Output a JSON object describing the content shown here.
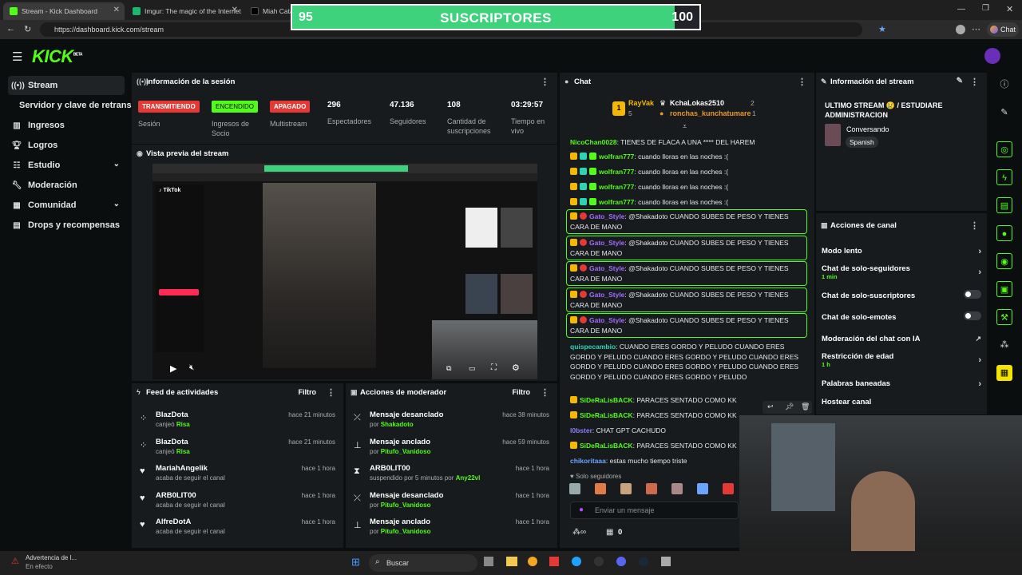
{
  "browser": {
    "tabs": [
      {
        "title": "Stream - Kick Dashboard",
        "active": true
      },
      {
        "title": "Imgur: The magic of the Internet",
        "active": false
      },
      {
        "title": "Miah Catali",
        "active": false
      }
    ],
    "url": "https://dashboard.kick.com/stream",
    "chat_button": "Chat"
  },
  "overlay": {
    "left": "95",
    "center": "SUSCRIPTORES",
    "right": "100",
    "progress": 0.94
  },
  "app": {
    "logo": "KICK",
    "logo_sup": "BETA"
  },
  "sidebar": {
    "items": [
      {
        "label": "Stream",
        "icon": "stream-icon"
      },
      {
        "label": "Servidor y clave de retransm",
        "icon": ""
      },
      {
        "label": "Ingresos",
        "icon": "chart-icon"
      },
      {
        "label": "Logros",
        "icon": "trophy-icon"
      },
      {
        "label": "Estudio",
        "icon": "sliders-icon"
      },
      {
        "label": "Moderación",
        "icon": "wrench-icon"
      },
      {
        "label": "Comunidad",
        "icon": "community-icon"
      },
      {
        "label": "Drops y recompensas",
        "icon": "gift-icon"
      }
    ]
  },
  "session": {
    "title": "Información de la sesión",
    "statuses": [
      {
        "badge": "TRANSMITIENDO",
        "label": "Sesión",
        "color": "#e53935"
      },
      {
        "badge": "ENCENDIDO",
        "label": "Ingresos de Socio",
        "color": "#53fc18"
      },
      {
        "badge": "APAGADO",
        "label": "Multistream",
        "color": "#e53935"
      }
    ],
    "stats": [
      {
        "value": "296",
        "label": "Espectadores"
      },
      {
        "value": "47.136",
        "label": "Seguidores"
      },
      {
        "value": "108",
        "label": "Cantidad de suscripciones"
      },
      {
        "value": "03:29:57",
        "label": "Tiempo en vivo"
      }
    ]
  },
  "preview": {
    "title": "Vista previa del stream"
  },
  "activity": {
    "title": "Feed de actividades",
    "filter": "Filtro",
    "rows": [
      {
        "name": "BlazDota",
        "sub": "canjeó",
        "sub_hl": "Risa",
        "time": "hace 21 minutos",
        "icon": "redeem-icon"
      },
      {
        "name": "BlazDota",
        "sub": "canjeó",
        "sub_hl": "Risa",
        "time": "hace 21 minutos",
        "icon": "redeem-icon"
      },
      {
        "name": "MariahAngelik",
        "sub": "acaba de seguir el canal",
        "sub_hl": "",
        "time": "hace 1 hora",
        "icon": "heart-icon"
      },
      {
        "name": "ARB0LIT00",
        "sub": "acaba de seguir el canal",
        "sub_hl": "",
        "time": "hace 1 hora",
        "icon": "heart-icon"
      },
      {
        "name": "AlfreDotA",
        "sub": "acaba de seguir el canal",
        "sub_hl": "",
        "time": "hace 1 hora",
        "icon": "heart-icon"
      }
    ]
  },
  "modactions": {
    "title": "Acciones de moderador",
    "filter": "Filtro",
    "rows": [
      {
        "name": "Mensaje desanclado",
        "sub": "por",
        "sub_hl": "Shakadoto",
        "time": "hace 38 minutos",
        "icon": "unpin-icon"
      },
      {
        "name": "Mensaje anclado",
        "sub": "por",
        "sub_hl": "Pitufo_Vanidoso",
        "time": "hace 59 minutos",
        "icon": "pin-icon"
      },
      {
        "name": "ARB0LIT00",
        "sub": "suspendido por 5 minutos por",
        "sub_hl": "Any22vl",
        "time": "hace 1 hora",
        "icon": "hourglass-icon"
      },
      {
        "name": "Mensaje desanclado",
        "sub": "por",
        "sub_hl": "Pitufo_Vanidoso",
        "time": "hace 1 hora",
        "icon": "unpin-icon"
      },
      {
        "name": "Mensaje anclado",
        "sub": "por",
        "sub_hl": "Pitufo_Vanidoso",
        "time": "hace 1 hora",
        "icon": "pin-icon"
      }
    ]
  },
  "chat": {
    "title": "Chat",
    "top": [
      {
        "name": "RayVak",
        "count": "5"
      },
      {
        "name": "KchaLokas2510",
        "count": "2"
      },
      {
        "name": "ronchas_kunchatumare",
        "count": "1"
      }
    ],
    "messages": [
      {
        "user": "NicoChan0028",
        "text": ": TIENES DE FLACA A UNA **** DEL HAREM",
        "color": "#53fc18",
        "hl": false
      },
      {
        "user": "wolfran777",
        "text": ": cuando lloras en las noches :(",
        "color": "#53fc18",
        "hl": false
      },
      {
        "user": "wolfran777",
        "text": ": cuando lloras en las noches :(",
        "color": "#53fc18",
        "hl": false
      },
      {
        "user": "wolfran777",
        "text": ": cuando lloras en las noches :(",
        "color": "#53fc18",
        "hl": false
      },
      {
        "user": "wolfran777",
        "text": ": cuando lloras en las noches :(",
        "color": "#53fc18",
        "hl": false
      },
      {
        "user": "Gato_Style",
        "text": ": @Shakadoto CUANDO SUBES DE PESO Y TIENES CARA DE MANO",
        "color": "#a36bff",
        "hl": true
      },
      {
        "user": "Gato_Style",
        "text": ": @Shakadoto CUANDO SUBES DE PESO Y TIENES CARA DE MANO",
        "color": "#a36bff",
        "hl": true
      },
      {
        "user": "Gato_Style",
        "text": ": @Shakadoto CUANDO SUBES DE PESO Y TIENES CARA DE MANO",
        "color": "#a36bff",
        "hl": true
      },
      {
        "user": "Gato_Style",
        "text": ": @Shakadoto CUANDO SUBES DE PESO Y TIENES CARA DE MANO",
        "color": "#a36bff",
        "hl": true
      },
      {
        "user": "Gato_Style",
        "text": ": @Shakadoto CUANDO SUBES DE PESO Y TIENES CARA DE MANO",
        "color": "#a36bff",
        "hl": true
      },
      {
        "user": "quispecambio",
        "text": ": CUANDO ERES GORDO Y PELUDO CUANDO ERES GORDO Y PELUDO CUANDO ERES GORDO Y PELUDO CUANDO ERES GORDO Y PELUDO CUANDO ERES GORDO Y PELUDO CUANDO ERES GORDO Y PELUDO CUANDO ERES GORDO Y PELUDO",
        "color": "#2bd4b4",
        "hl": false
      },
      {
        "user": "SiDeRaLisBACK",
        "text": ": PARACES SENTADO COMO KK",
        "color": "#53fc18",
        "hl": false
      },
      {
        "user": "SiDeRaLisBACK",
        "text": ": PARACES SENTADO COMO KK",
        "color": "#53fc18",
        "hl": false
      },
      {
        "user": "l0bster",
        "text": ": CHAT GPT CACHUDO",
        "color": "#8f7cff",
        "hl": false
      },
      {
        "user": "SiDeRaLisBACK",
        "text": ": PARACES SENTADO COMO KK",
        "color": "#53fc18",
        "hl": false
      },
      {
        "user": "chikoritaaa",
        "text": ": estas mucho tiempo triste",
        "color": "#6aa6ff",
        "hl": false
      }
    ],
    "followers_only": "Solo seguidores",
    "input_placeholder": "Enviar un mensaje",
    "points": "0"
  },
  "streaminfo": {
    "title": "Información del stream",
    "stream_title": "ULTIMO STREAM 😢 / ESTUDIARE ADMINISTRACION",
    "category": "Conversando",
    "language": "Spanish"
  },
  "channel_actions": {
    "title": "Acciones de canal",
    "items": [
      {
        "label": "Modo lento",
        "sub": "",
        "control": "chevron"
      },
      {
        "label": "Chat de solo-seguidores",
        "sub": "1 min",
        "control": "chevron"
      },
      {
        "label": "Chat de solo-suscriptores",
        "sub": "",
        "control": "toggle"
      },
      {
        "label": "Chat de solo-emotes",
        "sub": "",
        "control": "toggle"
      },
      {
        "label": "Moderación del chat con IA",
        "sub": "",
        "control": "external"
      },
      {
        "label": "Restricción de edad",
        "sub": "1 h",
        "control": "chevron"
      },
      {
        "label": "Palabras baneadas",
        "sub": "",
        "control": "chevron"
      },
      {
        "label": "Hostear canal",
        "sub": "",
        "control": "none"
      }
    ]
  },
  "taskbar": {
    "warning_title": "Advertencia de l...",
    "warning_sub": "En efecto",
    "search": "Buscar"
  },
  "colors": {
    "accent": "#53fc18",
    "panel": "#181b1d",
    "bg": "#0b0e0f",
    "danger": "#e53935"
  }
}
